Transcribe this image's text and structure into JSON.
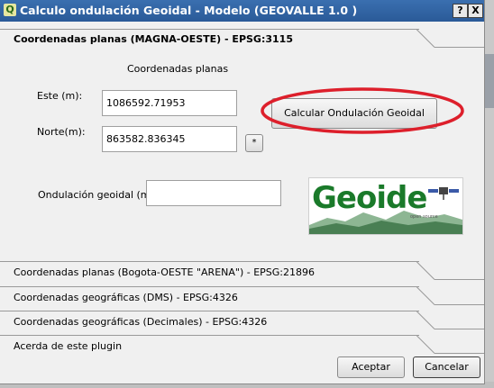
{
  "window": {
    "title": "Calculo ondulación Geoidal - Modelo (GEOVALLE 1.0 )",
    "help_label": "?",
    "close_label": "X"
  },
  "section1": {
    "title": "Coordenadas planas (MAGNA-OESTE) - EPSG:3115",
    "subtitle": "Coordenadas planas",
    "este_label": "Este (m):",
    "este_value": "1086592.71953",
    "norte_label": "Norte(m):",
    "norte_value": "863582.836345",
    "star_label": "*",
    "calc_label": "Calcular Ondulación Geoidal",
    "ond_label": "Ondulación geoidal (m):",
    "ond_value": "",
    "logo": {
      "text": "Geoide",
      "subtext": "open source"
    },
    "highlight_color": "#dd1f2b"
  },
  "sections": [
    {
      "label": "Coordenadas planas (Bogota-OESTE \"ARENA\") - EPSG:21896"
    },
    {
      "label": "Coordenadas geográficas (DMS) - EPSG:4326"
    },
    {
      "label": "Coordenadas geográficas (Decimales)  - EPSG:4326"
    },
    {
      "label": "Acerda de este plugin"
    }
  ],
  "buttons": {
    "accept": "Aceptar",
    "cancel": "Cancelar"
  }
}
